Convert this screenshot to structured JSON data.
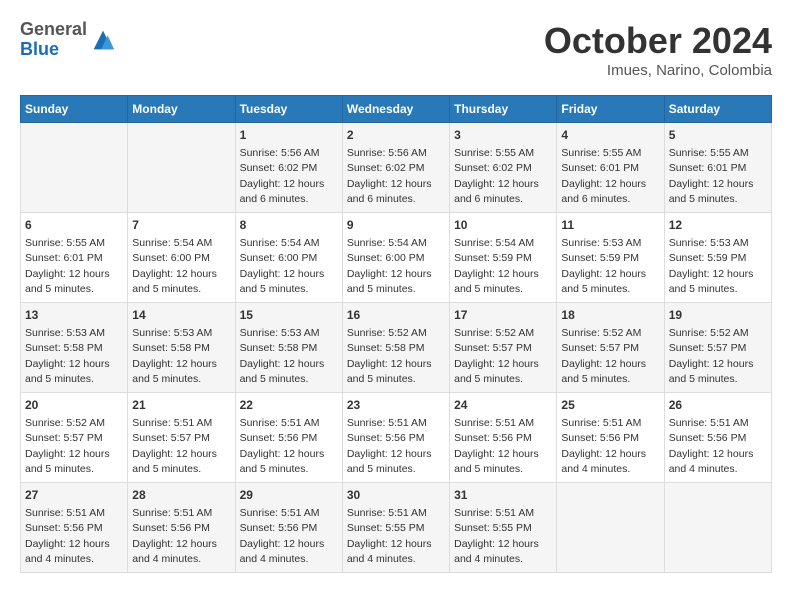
{
  "header": {
    "logo": {
      "general": "General",
      "blue": "Blue"
    },
    "title": "October 2024",
    "subtitle": "Imues, Narino, Colombia"
  },
  "weekdays": [
    "Sunday",
    "Monday",
    "Tuesday",
    "Wednesday",
    "Thursday",
    "Friday",
    "Saturday"
  ],
  "weeks": [
    [
      {
        "day": "",
        "info": ""
      },
      {
        "day": "",
        "info": ""
      },
      {
        "day": "1",
        "info": "Sunrise: 5:56 AM\nSunset: 6:02 PM\nDaylight: 12 hours\nand 6 minutes."
      },
      {
        "day": "2",
        "info": "Sunrise: 5:56 AM\nSunset: 6:02 PM\nDaylight: 12 hours\nand 6 minutes."
      },
      {
        "day": "3",
        "info": "Sunrise: 5:55 AM\nSunset: 6:02 PM\nDaylight: 12 hours\nand 6 minutes."
      },
      {
        "day": "4",
        "info": "Sunrise: 5:55 AM\nSunset: 6:01 PM\nDaylight: 12 hours\nand 6 minutes."
      },
      {
        "day": "5",
        "info": "Sunrise: 5:55 AM\nSunset: 6:01 PM\nDaylight: 12 hours\nand 5 minutes."
      }
    ],
    [
      {
        "day": "6",
        "info": "Sunrise: 5:55 AM\nSunset: 6:01 PM\nDaylight: 12 hours\nand 5 minutes."
      },
      {
        "day": "7",
        "info": "Sunrise: 5:54 AM\nSunset: 6:00 PM\nDaylight: 12 hours\nand 5 minutes."
      },
      {
        "day": "8",
        "info": "Sunrise: 5:54 AM\nSunset: 6:00 PM\nDaylight: 12 hours\nand 5 minutes."
      },
      {
        "day": "9",
        "info": "Sunrise: 5:54 AM\nSunset: 6:00 PM\nDaylight: 12 hours\nand 5 minutes."
      },
      {
        "day": "10",
        "info": "Sunrise: 5:54 AM\nSunset: 5:59 PM\nDaylight: 12 hours\nand 5 minutes."
      },
      {
        "day": "11",
        "info": "Sunrise: 5:53 AM\nSunset: 5:59 PM\nDaylight: 12 hours\nand 5 minutes."
      },
      {
        "day": "12",
        "info": "Sunrise: 5:53 AM\nSunset: 5:59 PM\nDaylight: 12 hours\nand 5 minutes."
      }
    ],
    [
      {
        "day": "13",
        "info": "Sunrise: 5:53 AM\nSunset: 5:58 PM\nDaylight: 12 hours\nand 5 minutes."
      },
      {
        "day": "14",
        "info": "Sunrise: 5:53 AM\nSunset: 5:58 PM\nDaylight: 12 hours\nand 5 minutes."
      },
      {
        "day": "15",
        "info": "Sunrise: 5:53 AM\nSunset: 5:58 PM\nDaylight: 12 hours\nand 5 minutes."
      },
      {
        "day": "16",
        "info": "Sunrise: 5:52 AM\nSunset: 5:58 PM\nDaylight: 12 hours\nand 5 minutes."
      },
      {
        "day": "17",
        "info": "Sunrise: 5:52 AM\nSunset: 5:57 PM\nDaylight: 12 hours\nand 5 minutes."
      },
      {
        "day": "18",
        "info": "Sunrise: 5:52 AM\nSunset: 5:57 PM\nDaylight: 12 hours\nand 5 minutes."
      },
      {
        "day": "19",
        "info": "Sunrise: 5:52 AM\nSunset: 5:57 PM\nDaylight: 12 hours\nand 5 minutes."
      }
    ],
    [
      {
        "day": "20",
        "info": "Sunrise: 5:52 AM\nSunset: 5:57 PM\nDaylight: 12 hours\nand 5 minutes."
      },
      {
        "day": "21",
        "info": "Sunrise: 5:51 AM\nSunset: 5:57 PM\nDaylight: 12 hours\nand 5 minutes."
      },
      {
        "day": "22",
        "info": "Sunrise: 5:51 AM\nSunset: 5:56 PM\nDaylight: 12 hours\nand 5 minutes."
      },
      {
        "day": "23",
        "info": "Sunrise: 5:51 AM\nSunset: 5:56 PM\nDaylight: 12 hours\nand 5 minutes."
      },
      {
        "day": "24",
        "info": "Sunrise: 5:51 AM\nSunset: 5:56 PM\nDaylight: 12 hours\nand 5 minutes."
      },
      {
        "day": "25",
        "info": "Sunrise: 5:51 AM\nSunset: 5:56 PM\nDaylight: 12 hours\nand 4 minutes."
      },
      {
        "day": "26",
        "info": "Sunrise: 5:51 AM\nSunset: 5:56 PM\nDaylight: 12 hours\nand 4 minutes."
      }
    ],
    [
      {
        "day": "27",
        "info": "Sunrise: 5:51 AM\nSunset: 5:56 PM\nDaylight: 12 hours\nand 4 minutes."
      },
      {
        "day": "28",
        "info": "Sunrise: 5:51 AM\nSunset: 5:56 PM\nDaylight: 12 hours\nand 4 minutes."
      },
      {
        "day": "29",
        "info": "Sunrise: 5:51 AM\nSunset: 5:56 PM\nDaylight: 12 hours\nand 4 minutes."
      },
      {
        "day": "30",
        "info": "Sunrise: 5:51 AM\nSunset: 5:55 PM\nDaylight: 12 hours\nand 4 minutes."
      },
      {
        "day": "31",
        "info": "Sunrise: 5:51 AM\nSunset: 5:55 PM\nDaylight: 12 hours\nand 4 minutes."
      },
      {
        "day": "",
        "info": ""
      },
      {
        "day": "",
        "info": ""
      }
    ]
  ]
}
